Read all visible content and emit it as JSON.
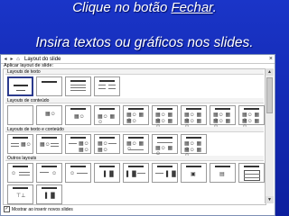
{
  "slide": {
    "line1_prefix": "Clique no botão ",
    "line1_link": "Fechar",
    "line1_suffix": ".",
    "line2": "Insira textos ou gráficos nos slides."
  },
  "pane": {
    "title": "Layout do slide",
    "close_glyph": "×",
    "apply_label": "Aplicar layout de slide:",
    "sections": [
      {
        "label": "Layouts de texto"
      },
      {
        "label": "Layouts de conteúdo"
      },
      {
        "label": "Layouts de texto e conteúdo"
      },
      {
        "label": "Outros layouts"
      }
    ],
    "show_on_insert_label": "Mostrar ao inserir novos slides",
    "show_on_insert_checked": "✓"
  },
  "colors": {
    "background": "#1a35c8",
    "selection": "#2b3a8c"
  },
  "icons": {
    "back": "◂",
    "forward": "▸",
    "home": "⌂",
    "close": "×",
    "scroll_up": "▲",
    "scroll_down": "▼"
  }
}
